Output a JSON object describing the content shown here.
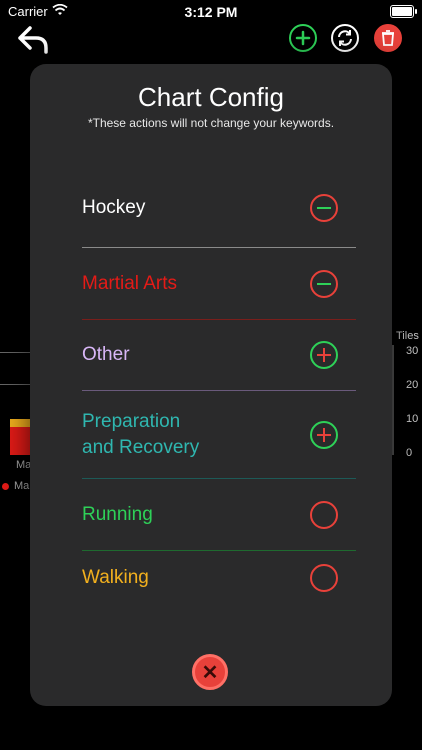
{
  "status_bar": {
    "carrier": "Carrier",
    "time": "3:12 PM"
  },
  "background": {
    "right_axis_title": "Tiles",
    "right_axis_ticks": [
      "30",
      "20",
      "10",
      "0"
    ],
    "bar_label": "Ma",
    "legend_label": "Ma"
  },
  "modal": {
    "title": "Chart Config",
    "subtitle": "*These actions will not change your keywords.",
    "items": [
      {
        "label": "Hockey",
        "color": "#ffffff",
        "action": "remove",
        "icon_color": "#e8413a"
      },
      {
        "label": "Martial Arts",
        "color": "#e41b17",
        "action": "remove",
        "icon_color": "#e8413a"
      },
      {
        "label": "Other",
        "color": "#d8b6f7",
        "action": "add",
        "icon_color": "#2ed158"
      },
      {
        "label": "Preparation and Recovery",
        "label_line1": "Preparation",
        "label_line2": "and Recovery",
        "color": "#2fb7b0",
        "action": "add",
        "icon_color": "#2ed158"
      },
      {
        "label": "Running",
        "color": "#2ed158",
        "action": "remove",
        "icon_color": "#e8413a"
      },
      {
        "label": "Walking",
        "color": "#f2b01e",
        "action": "remove",
        "icon_color": "#e8413a"
      }
    ],
    "close_glyph": "✕"
  },
  "colors": {
    "accent_green": "#2ed158",
    "accent_red": "#e8413a",
    "modal_bg": "#2a2a2b"
  }
}
